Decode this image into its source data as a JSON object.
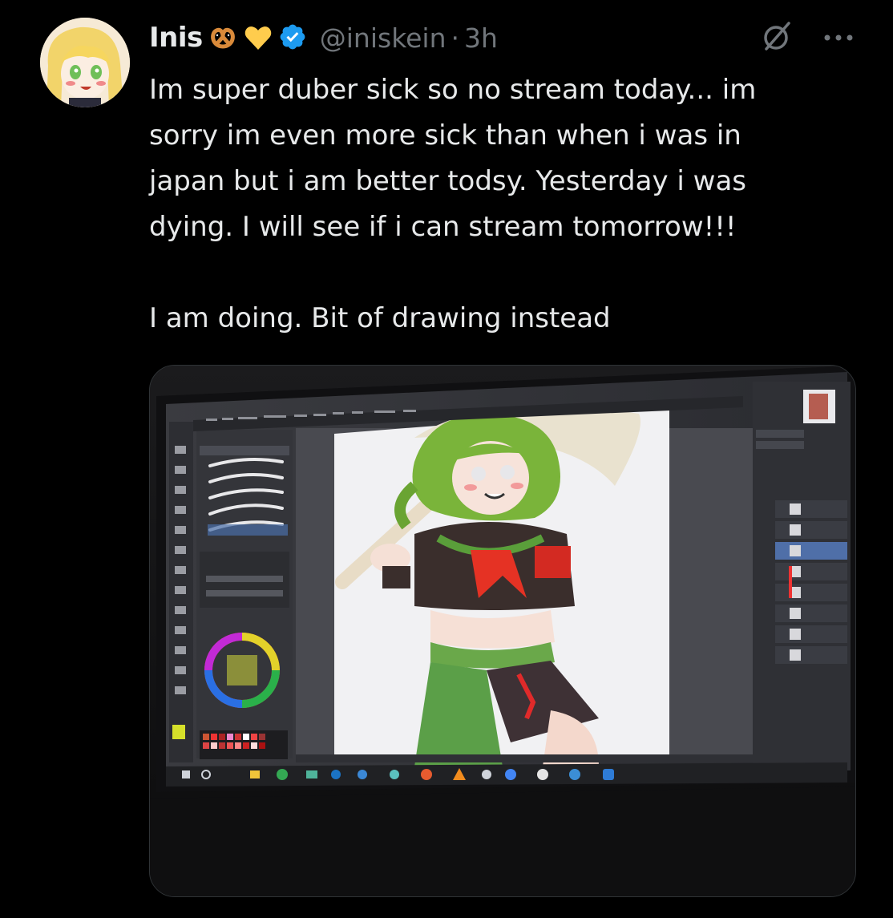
{
  "tweet": {
    "author_name": "Inis",
    "author_handle": "@iniskein",
    "separator": "·",
    "time": "3h",
    "text_line1": "Im super duber sick so no stream today... im",
    "text_line2": "sorry im even more sick than when i was in",
    "text_line3": "japan but i am better todsy. Yesterday i was",
    "text_line4": "dying. I will see if i can stream tomorrow!!!",
    "text_line6": "I am doing. Bit of drawing instead"
  },
  "icons": {
    "author_emojis": [
      "pretzel-icon",
      "yellow-heart-icon"
    ],
    "verified": "verified-badge-icon",
    "grok": "grok-icon",
    "more": "more-icon"
  },
  "colors": {
    "verified_blue": "#1d9bf0",
    "secondary_text": "#71767b",
    "primary_text": "#e7e9ea"
  }
}
